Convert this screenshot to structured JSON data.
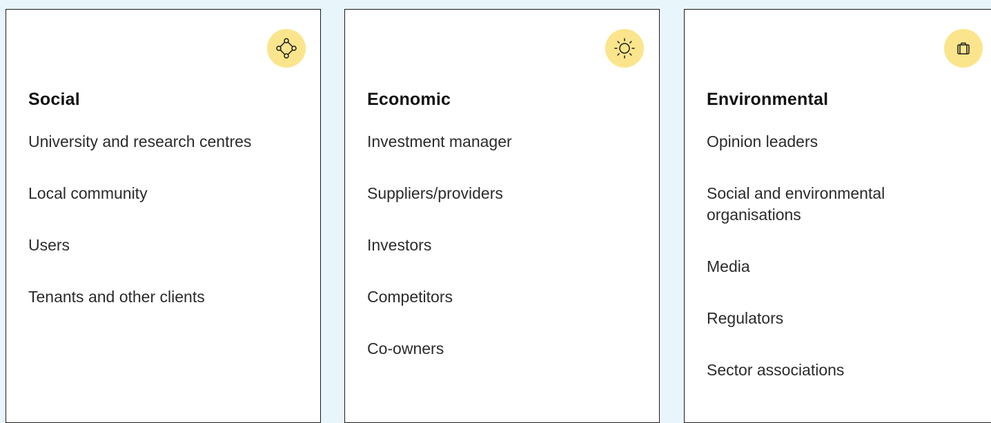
{
  "colors": {
    "background": "#e8f6fb",
    "card": "#ffffff",
    "border": "#1a1a1a",
    "icon_badge": "#fbe58c"
  },
  "cards": [
    {
      "title": "Social",
      "icon": "network-nodes-icon",
      "items": [
        "University and research centres",
        "Local community",
        "Users",
        "Tenants and other clients"
      ]
    },
    {
      "title": "Economic",
      "icon": "sun-icon",
      "items": [
        "Investment manager",
        "Suppliers/providers",
        "Investors",
        "Competitors",
        "Co-owners"
      ]
    },
    {
      "title": "Environmental",
      "icon": "briefcase-icon",
      "items": [
        "Opinion leaders",
        "Social and environmental organisations",
        "Media",
        "Regulators",
        "Sector associations"
      ]
    }
  ]
}
